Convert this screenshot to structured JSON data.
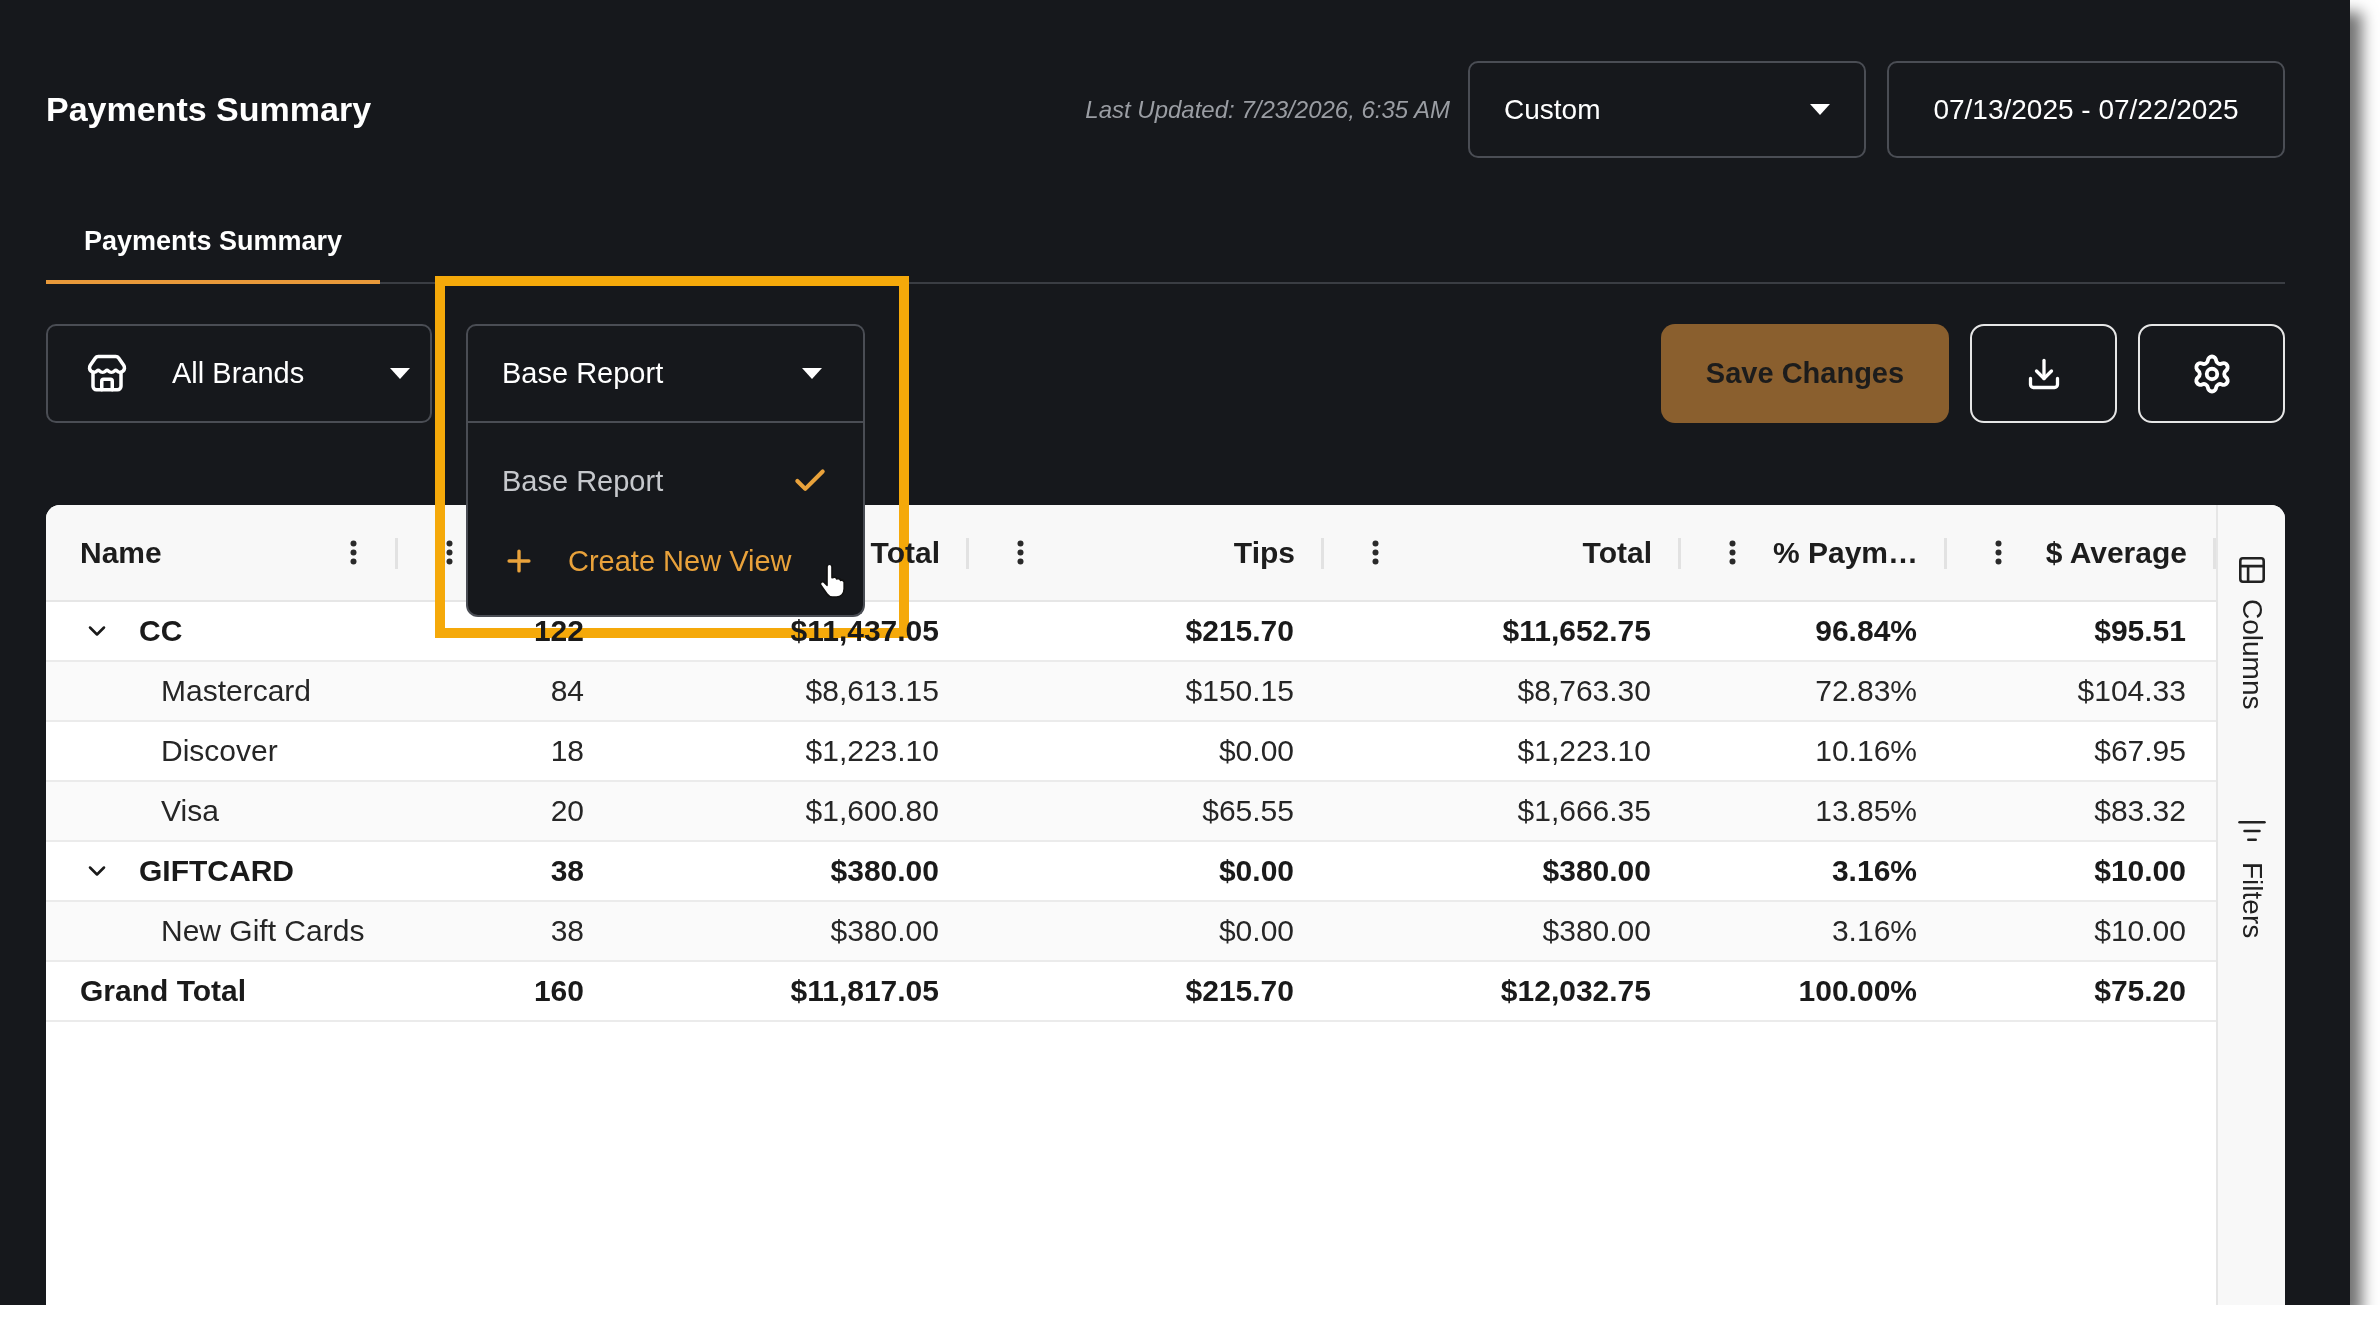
{
  "header": {
    "title": "Payments Summary",
    "last_updated": "Last Updated: 7/23/2026, 6:35 AM",
    "period_select": {
      "value": "Custom"
    },
    "date_range": {
      "value": "07/13/2025 - 07/22/2025"
    }
  },
  "tabs": [
    {
      "label": "Payments Summary",
      "selected": true
    }
  ],
  "toolbar": {
    "brand_select": {
      "value": "All Brands"
    },
    "view_select": {
      "value": "Base Report",
      "expanded": true,
      "options": [
        {
          "kind": "option",
          "label": "Base Report",
          "selected": true
        },
        {
          "kind": "action",
          "label": "Create New View",
          "selected": false
        }
      ]
    },
    "buttons": [
      {
        "kind": "save",
        "label": "Save Changes"
      },
      {
        "kind": "download"
      },
      {
        "kind": "settings"
      }
    ]
  },
  "table": {
    "columns": [
      {
        "kind": "text",
        "label": "Name"
      },
      {
        "kind": "number"
      },
      {
        "kind": "number",
        "label": "Total"
      },
      {
        "kind": "number",
        "label": "Tips"
      },
      {
        "kind": "number",
        "label": "Total"
      },
      {
        "kind": "number",
        "label": "% Paym…"
      },
      {
        "kind": "number",
        "label": "$ Average"
      }
    ],
    "rows": [
      {
        "kind": "group",
        "name": "CC",
        "expanded": true,
        "values": [
          "122",
          "$11,437.05",
          "$215.70",
          "$11,652.75",
          "96.84%",
          "$95.51"
        ],
        "children": [
          {
            "name": "Mastercard",
            "values": [
              "84",
              "$8,613.15",
              "$150.15",
              "$8,763.30",
              "72.83%",
              "$104.33"
            ]
          },
          {
            "name": "Discover",
            "values": [
              "18",
              "$1,223.10",
              "$0.00",
              "$1,223.10",
              "10.16%",
              "$67.95"
            ]
          },
          {
            "name": "Visa",
            "values": [
              "20",
              "$1,600.80",
              "$65.55",
              "$1,666.35",
              "13.85%",
              "$83.32"
            ]
          }
        ]
      },
      {
        "kind": "group",
        "name": "GIFTCARD",
        "expanded": true,
        "values": [
          "38",
          "$380.00",
          "$0.00",
          "$380.00",
          "3.16%",
          "$10.00"
        ],
        "children": [
          {
            "name": "New Gift Cards",
            "values": [
              "38",
              "$380.00",
              "$0.00",
              "$380.00",
              "3.16%",
              "$10.00"
            ]
          }
        ]
      },
      {
        "kind": "total",
        "name": "Grand Total",
        "values": [
          "160",
          "$11,817.05",
          "$215.70",
          "$12,032.75",
          "100.00%",
          "$75.20"
        ]
      }
    ]
  },
  "side_panel": [
    {
      "kind": "columns",
      "label": "Columns"
    },
    {
      "kind": "filters",
      "label": "Filters"
    }
  ]
}
